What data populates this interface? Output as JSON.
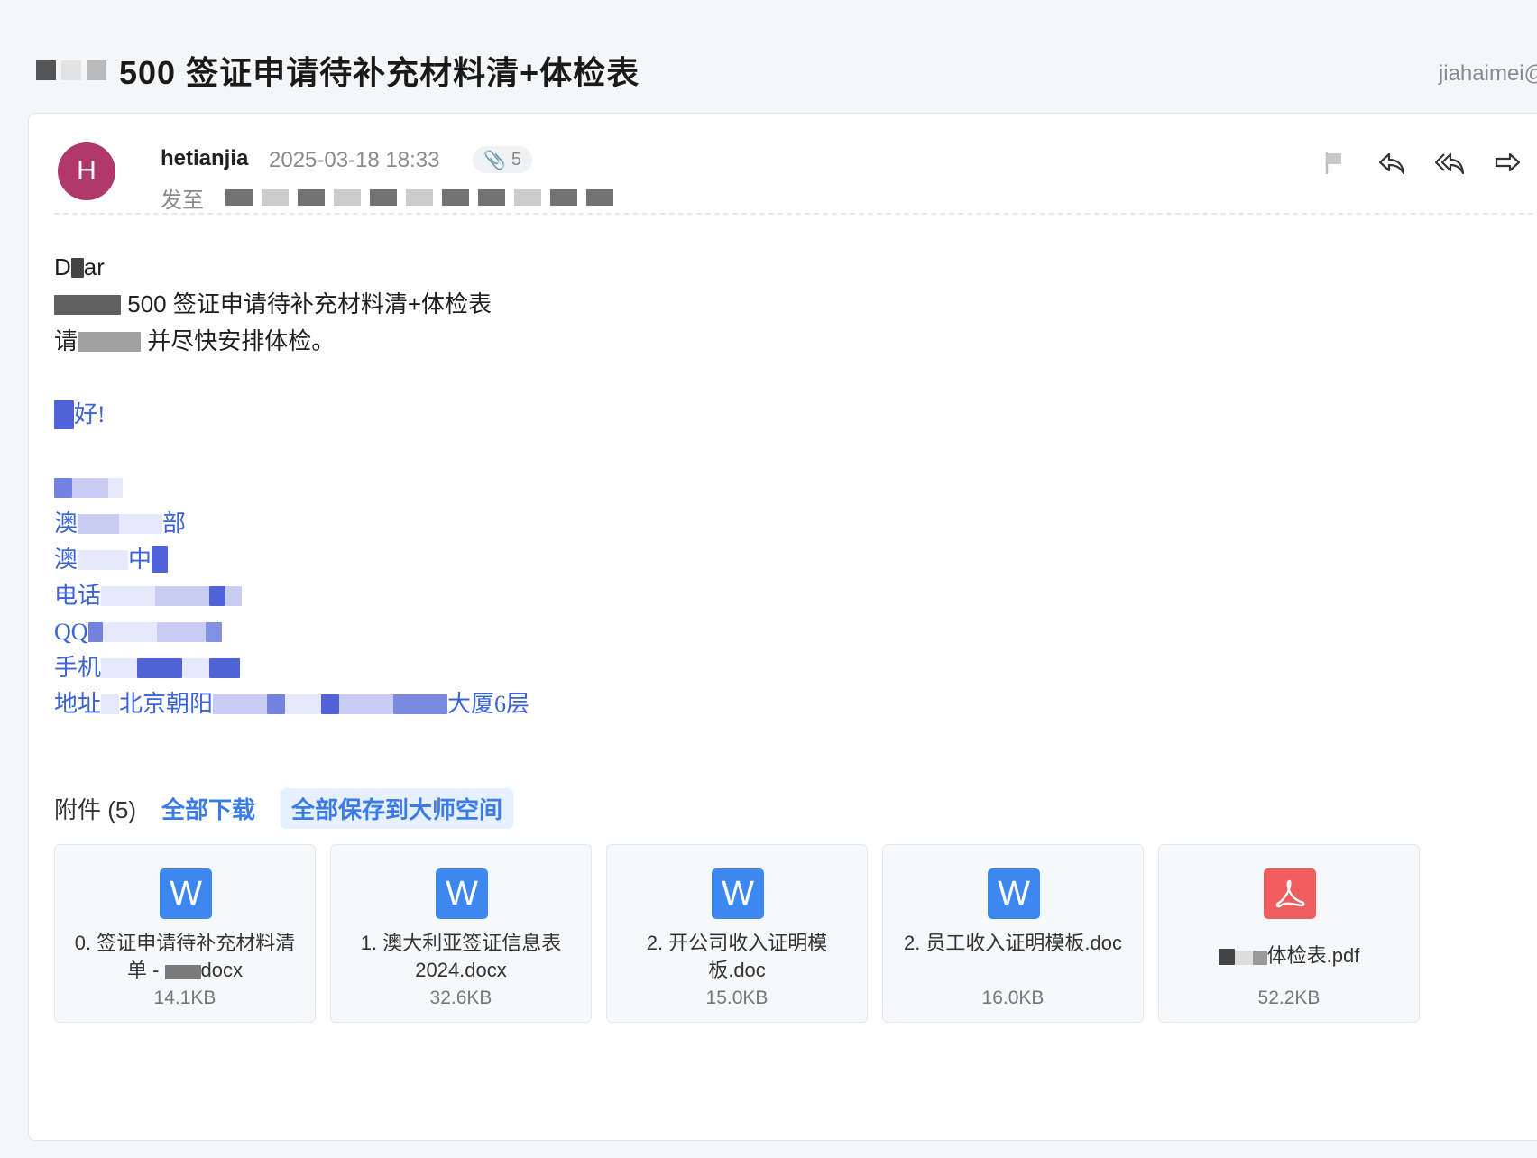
{
  "header": {
    "subject": "500 签证申请待补充材料清+体检表",
    "account": "jiahaimei@"
  },
  "message": {
    "avatar_letter": "H",
    "sender": "hetianjia",
    "time": "2025-03-18 18:33",
    "attachment_count": "5",
    "to_label": "发至"
  },
  "toolbar": {
    "flag_icon": "flag-icon",
    "reply_icon": "reply-icon",
    "reply_all_icon": "reply-all-icon",
    "forward_icon": "forward-icon"
  },
  "body": {
    "line1": "D",
    "line1b": "ar",
    "line2": "500 签证申请待补充材料清+体检表",
    "line3a": "请",
    "line3b": "并尽快安排体检。",
    "greet": "好!",
    "sig_dept_tail": "部",
    "sig_line2a": "澳",
    "sig_line2b": "中",
    "sig_line1a": "澳",
    "sig_phone": "电话",
    "sig_qq": "QQ",
    "sig_mobile": "手机",
    "sig_addr_label": "地址",
    "sig_addr_a": "北京朝阳",
    "sig_addr_b": "大厦6层"
  },
  "attachments": {
    "title": "附件 (5)",
    "download_all": "全部下载",
    "save_all": "全部保存到大师空间",
    "files": [
      {
        "name": "0. 签证申请待补充材料清单 - ",
        "ext": "docx",
        "size": "14.1KB",
        "type": "word"
      },
      {
        "name": "1. 澳大利亚签证信息表2024.docx",
        "size": "32.6KB",
        "type": "word"
      },
      {
        "name": "2. 开公司收入证明模板.doc",
        "size": "15.0KB",
        "type": "word"
      },
      {
        "name": "2. 员工收入证明模板.doc",
        "size": "16.0KB",
        "type": "word"
      },
      {
        "name": "体检表.pdf",
        "size": "52.2KB",
        "type": "pdf"
      }
    ]
  },
  "colors": {
    "accent": "#3b7be8",
    "avatar": "#b0386a",
    "signature": "#3b63d6"
  }
}
